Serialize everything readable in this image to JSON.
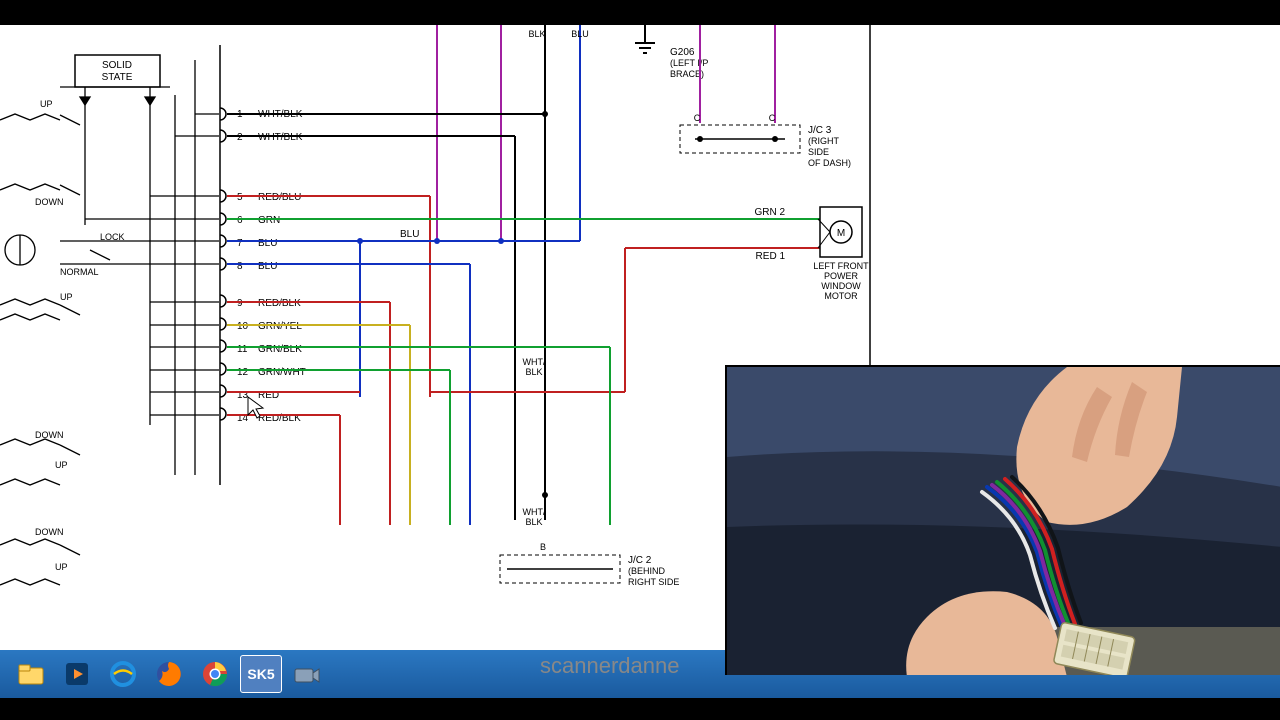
{
  "ground": {
    "label": "G206",
    "sub1": "(LEFT I/P",
    "sub2": "BRACE)"
  },
  "jc3": {
    "label": "J/C 3",
    "sub1": "(RIGHT",
    "sub2": "SIDE",
    "sub3": "OF DASH)"
  },
  "motor": {
    "line1": "LEFT FRONT",
    "line2": "POWER",
    "line3": "WINDOW",
    "line4": "MOTOR"
  },
  "jc2": {
    "label": "J/C 2",
    "sub1": "(BEHIND",
    "sub2": "RIGHT SIDE"
  },
  "solidstate": {
    "line1": "SOLID",
    "line2": "STATE"
  },
  "pins": {
    "p1": {
      "num": "1",
      "color": "WHT/BLK"
    },
    "p2": {
      "num": "2",
      "color": "WHT/BLK"
    },
    "p5": {
      "num": "5",
      "color": "RED/BLU"
    },
    "p6": {
      "num": "6",
      "color": "GRN"
    },
    "p7": {
      "num": "7",
      "color": "BLU"
    },
    "p8": {
      "num": "8",
      "color": "BLU"
    },
    "p9": {
      "num": "9",
      "color": "RED/BLK"
    },
    "p10": {
      "num": "10",
      "color": "GRN/YEL"
    },
    "p11": {
      "num": "11",
      "color": "GRN/BLK"
    },
    "p12": {
      "num": "12",
      "color": "GRN/WHT"
    },
    "p13": {
      "num": "13",
      "color": "RED"
    },
    "p14": {
      "num": "14",
      "color": "RED/BLK"
    }
  },
  "wire_labels": {
    "blu_mid": "BLU",
    "wht_blk_v": "WHT/\nBLK",
    "wht_blk_v2": "WHT/\nBLK",
    "blk1": "BLK",
    "blu1": "BLU",
    "grn2": "GRN   2",
    "red1": "RED   1",
    "c1": "C",
    "c2": "C",
    "b1": "B"
  },
  "switch_labels": {
    "up1": "UP",
    "down1": "DOWN",
    "lock": "LOCK",
    "normal": "NORMAL",
    "up2": "UP",
    "down2": "DOWN",
    "up3": "UP",
    "down3": "DOWN",
    "up4": "UP"
  },
  "watermark": "scannerdanne",
  "taskbar": {
    "sk5": "SK5"
  }
}
